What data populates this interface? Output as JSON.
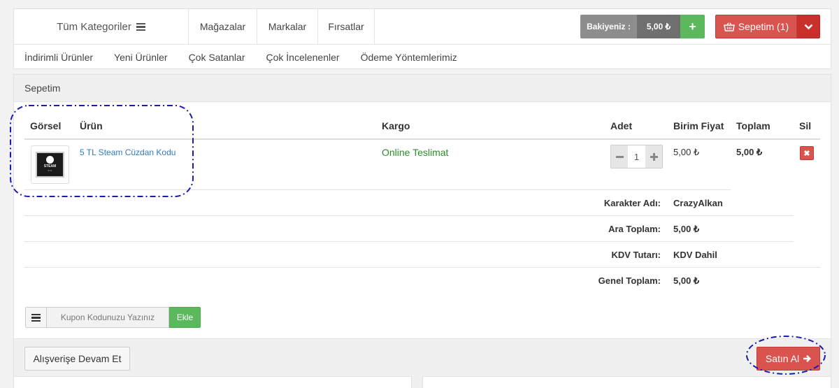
{
  "header": {
    "categories_label": "Tüm Kategoriler",
    "nav_links": [
      "Mağazalar",
      "Markalar",
      "Fırsatlar"
    ],
    "balance_label": "Bakiyeniz :",
    "balance_value": "5,00 ₺",
    "balance_add": "+",
    "cart_label": "Sepetim (1)",
    "sub_links": [
      "İndirimli Ürünler",
      "Yeni Ürünler",
      "Çok Satanlar",
      "Çok İncelenenler",
      "Ödeme Yöntemlerimiz"
    ]
  },
  "cart": {
    "title": "Sepetim",
    "columns": [
      "Görsel",
      "Ürün",
      "Kargo",
      "Adet",
      "Birim Fiyat",
      "Toplam",
      "Sil"
    ],
    "item": {
      "thumb_text": "STEAM",
      "thumb_value": "5 TL",
      "name": "5 TL Steam Cüzdan Kodu",
      "delivery": "Online Teslimat",
      "quantity": "1",
      "unit_price": "5,00 ₺",
      "total": "5,00 ₺",
      "delete_symbol": "✖"
    },
    "summary": [
      {
        "label": "Karakter Adı:",
        "value": "CrazyAlkan"
      },
      {
        "label": "Ara Toplam:",
        "value": "5,00 ₺"
      },
      {
        "label": "KDV Tutarı:",
        "value": "KDV Dahil"
      },
      {
        "label": "Genel Toplam:",
        "value": "5,00 ₺"
      }
    ],
    "coupon": {
      "placeholder": "Kupon Kodunuzu Yazınız",
      "add_label": "Ekle"
    },
    "continue_label": "Alışverişe Devam Et",
    "buy_label": "Satın Al"
  },
  "colors": {
    "accent_red": "#d9534f",
    "accent_green": "#5cb85c",
    "link_blue": "#337ab7",
    "highlight_ring": "#1a1ab0"
  }
}
